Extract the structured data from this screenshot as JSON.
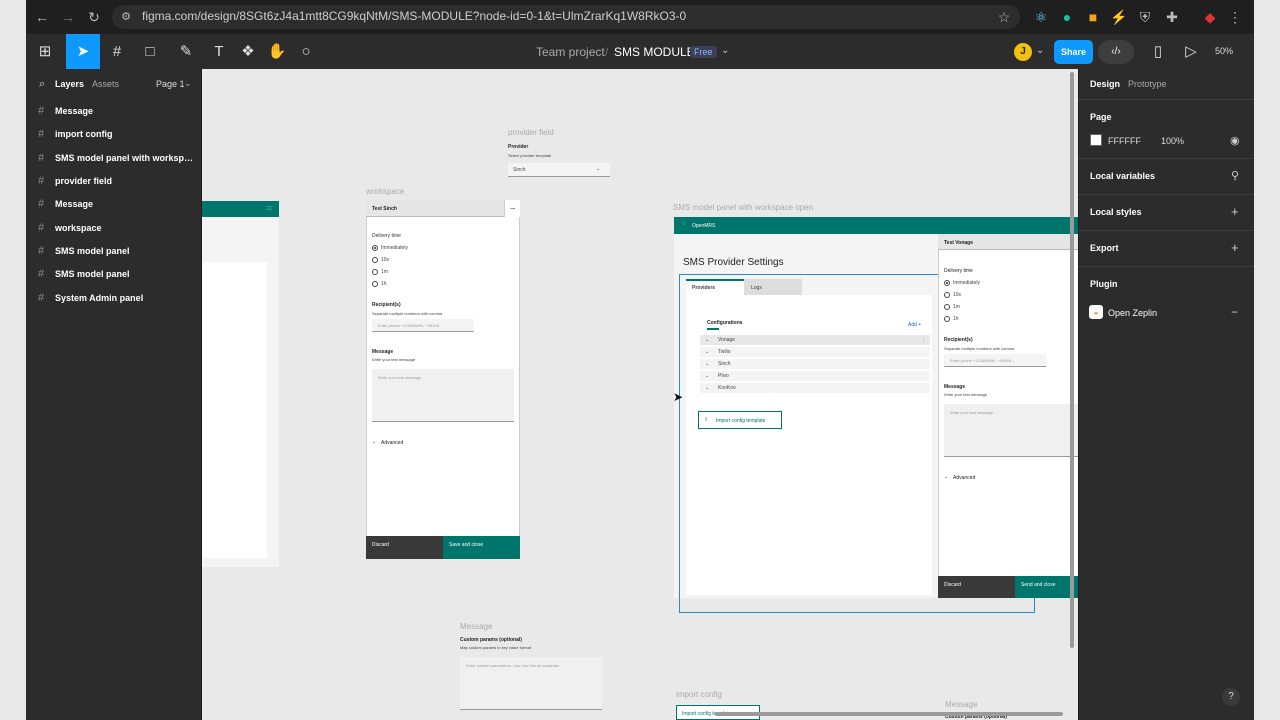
{
  "browser": {
    "url": "figma.com/design/8SGt6zJ4a1mtt8CG9kqNtM/SMS-MODULE?node-id=0-1&t=UlmZrarKq1W8RkO3-0"
  },
  "topbar": {
    "team": "Team project",
    "separator": "/",
    "file_name": "SMS MODULE",
    "plan_badge": "Free",
    "avatar_initial": "J",
    "share_label": "Share",
    "zoom": "50%"
  },
  "left_panel": {
    "tab_layers": "Layers",
    "tab_assets": "Assets",
    "page_selector": "Page 1",
    "layers": [
      "Message",
      "import config",
      "SMS model panel with workspace...",
      "provider field",
      "Message",
      "workspace",
      "SMS model panel",
      "SMS model panel",
      "System Admin panel"
    ]
  },
  "right_panel": {
    "tab_design": "Design",
    "tab_prototype": "Prototype",
    "page_heading": "Page",
    "page_color": "FFFFFF",
    "page_opacity": "100%",
    "local_variables": "Local variables",
    "local_styles": "Local styles",
    "export": "Export",
    "plugin_heading": "Plugin",
    "plugin_name": "Open Zeplin"
  },
  "canvas": {
    "provider_field": {
      "frame_label": "provider field",
      "label": "Provider",
      "help": "Select provider template",
      "value": "Sinch"
    },
    "workspace": {
      "frame_label": "workspace",
      "title": "Test Sinch",
      "delivery_label": "Delivery time",
      "delivery_options": [
        "Immediately",
        "10s",
        "1m",
        "1h"
      ],
      "recipients_label": "Recipient(s)",
      "recipients_help": "Separate multiple numbers with comma",
      "recipients_placeholder": "Enter phone +123455690, +09348...",
      "message_label": "Message",
      "message_help": "Write your test message",
      "message_placeholder": "Write your test message",
      "advanced": "Advanced",
      "discard": "Discard",
      "save": "Save and close"
    },
    "sms_panel": {
      "frame_label": "SMS model panel with workspace open",
      "brand": "OpenMRS",
      "page_title": "SMS Provider Settings",
      "tabs": [
        "Providers",
        "Logs"
      ],
      "config_heading": "Configurations",
      "add_label": "Add +",
      "providers": [
        "Vonage",
        "Twilio",
        "Sinch",
        "Plivo",
        "KooKoo"
      ],
      "import_button": "Import config template",
      "workspace_title": "Test Vonage",
      "delivery_label": "Delivery time",
      "delivery_options": [
        "Immediately",
        "10s",
        "1m",
        "1h"
      ],
      "recipients_label": "Recipient(s)",
      "recipients_help": "Separate multiple numbers with comma",
      "recipients_placeholder": "Enter phone +123455690, +09348...",
      "message_label": "Message",
      "message_help": "Write your test message",
      "message_placeholder": "Write your test message",
      "advanced": "Advanced",
      "discard": "Discard",
      "send": "Send and close"
    },
    "message_frame": {
      "frame_label": "Message",
      "label": "Custom params (optional)",
      "help": "Map custom params in key value format",
      "placeholder": "Enter custom parameters.  Use new line as separator"
    },
    "import_config_frame": {
      "frame_label": "import config",
      "button": "Import config template"
    },
    "message_frame_2": {
      "frame_label": "Message",
      "label": "Custom params (optional)"
    }
  },
  "colors": {
    "accent": "#0d99ff",
    "teal": "#00756b",
    "dark": "#2c2c2c"
  }
}
